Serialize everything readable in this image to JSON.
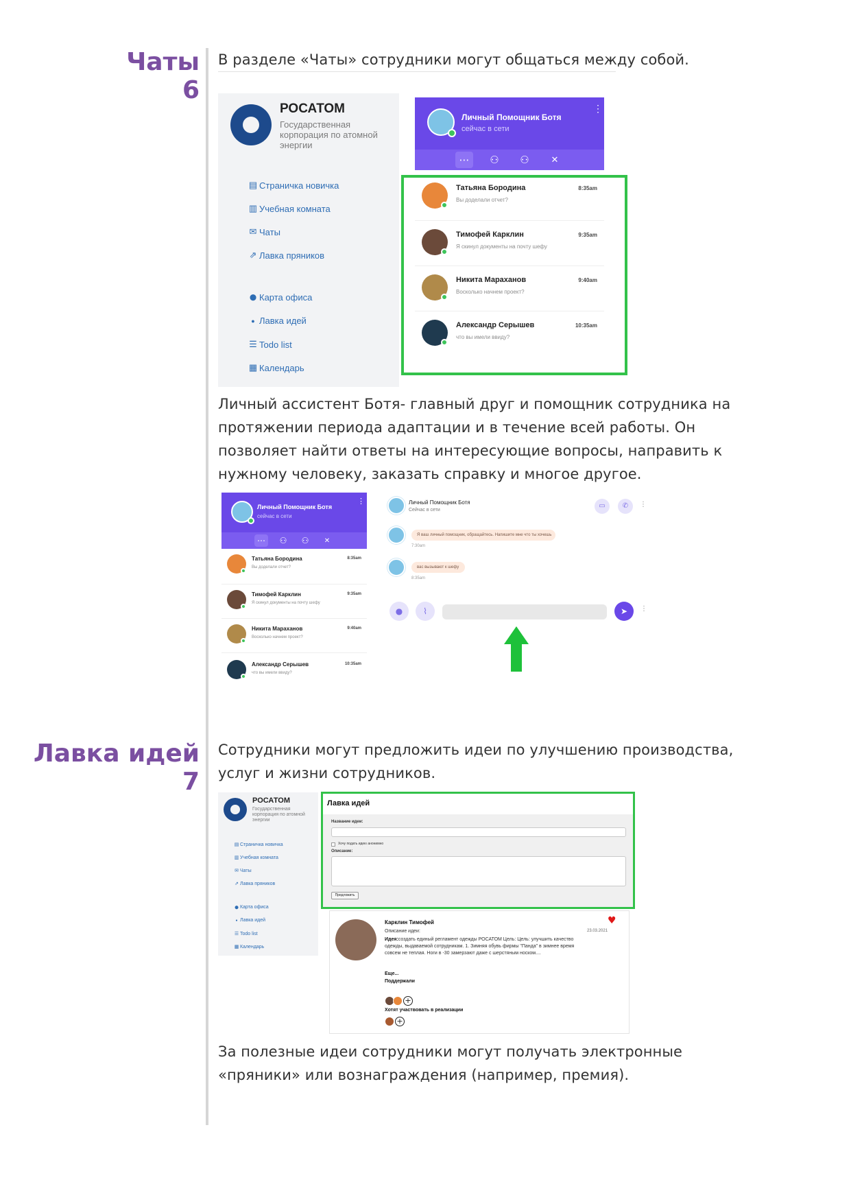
{
  "sections": {
    "chats": {
      "title": "Чаты",
      "number": "6",
      "intro": "В разделе «Чаты» сотрудники могут общаться между собой."
    },
    "bot_description": " Личный ассистент Ботя- главный друг и помощник сотрудника на протяжении периода адаптации и в течение всей работы. Он позволяет найти ответы на интересующие вопросы, направить к нужному человеку, заказать справку и многое другое.",
    "ideas": {
      "title": "Лавка идей",
      "number": "7",
      "intro": "Сотрудники могут предложить идеи по улучшению производства, услуг и жизни сотрудников."
    },
    "rewards_text": "За полезные идеи сотрудники могут получать электронные «пряники» или вознаграждения (например, премия)."
  },
  "portal": {
    "brand": "РОСАТОМ",
    "brand_sub": "Государственная корпорация по атомной энергии",
    "menu": [
      {
        "label": "Страничка новичка",
        "icon": "file-icon",
        "glyph": "▤"
      },
      {
        "label": "Учебная комната",
        "icon": "book-icon",
        "glyph": "▥"
      },
      {
        "label": "Чаты",
        "icon": "envelope-icon",
        "glyph": "✉"
      },
      {
        "label": "Лавка пряников",
        "icon": "chart-icon",
        "glyph": "⇗"
      },
      {
        "label": "Карта офиса",
        "icon": "map-pin-icon",
        "glyph": "⬤"
      },
      {
        "label": "Лавка идей",
        "icon": "lightbulb-icon",
        "glyph": "●"
      },
      {
        "label": "Todo list",
        "icon": "list-icon",
        "glyph": "☰"
      },
      {
        "label": "Календарь",
        "icon": "calendar-icon",
        "glyph": "▦"
      }
    ]
  },
  "bot": {
    "name": "Личный Помощник Ботя",
    "status": "сейчас в сети",
    "tabs": [
      {
        "icon": "chat-bubble-icon",
        "glyph": "⋯"
      },
      {
        "icon": "user-online-icon",
        "glyph": "⚇"
      },
      {
        "icon": "user-icon",
        "glyph": "⚇"
      },
      {
        "icon": "close-icon",
        "glyph": "✕"
      }
    ]
  },
  "chats": [
    {
      "name": "Татьяна Бородина",
      "message": "Вы доделали отчет?",
      "time": "8:35am",
      "avatar_color": "#e8873a"
    },
    {
      "name": "Тимофей Карклин",
      "message": "Я скинул документы на почту шефу",
      "time": "9:35am",
      "avatar_color": "#6b4a3a"
    },
    {
      "name": "Никита Мараханов",
      "message": "Восколько начнем проект?",
      "time": "9:40am",
      "avatar_color": "#b08a4a"
    },
    {
      "name": "Александр Серышев",
      "message": "что вы имели ввиду?",
      "time": "10:35am",
      "avatar_color": "#1f3a4f"
    }
  ],
  "conversation": {
    "bot_name": "Личный Помощник Ботя",
    "bot_status": "Сейчас в сети",
    "messages": [
      {
        "text": "Я ваш личный помощник, обращайтесь. Напишите мне что ты хочешь",
        "time": "7:30am"
      },
      {
        "text": "вас вызывают к шефу",
        "time": "8:35am"
      }
    ],
    "icons": {
      "video": "video-camera-icon",
      "phone": "phone-icon",
      "mic": "microphone-icon",
      "attach": "paperclip-icon",
      "send": "send-icon"
    }
  },
  "ideas_form": {
    "title": "Лавка идей",
    "name_label": "Название идеи:",
    "anonymous_label": "Хочу подать идею анонимно",
    "description_label": "Описание:",
    "submit_label": "Предложить"
  },
  "idea_card": {
    "author": "Карклин Тимофей",
    "date": "23.03.2021",
    "desc_label": "Описание идеи:",
    "idea_prefix": "Идея:",
    "idea_text": "создать единый регламент одежды РОСАТОМ Цель: Цель: улучшить качество одежды, выдаваемой сотрудникам. 1. Зимняя обувь фирмы \"Панда\" в зимнее время совсем не теплая. Ноги в -30 замерзают даже с шерстяным носком....",
    "more": "Еще...",
    "supported": "Поддержали",
    "want_participate": "Хотят участвовать в реализации"
  },
  "colors": {
    "heading_purple": "#7b4fa1",
    "bot_purple": "#6a48e8",
    "highlight_green": "#33c24a",
    "link_blue": "#2e6db4",
    "arrow_green": "#1ec13a"
  }
}
